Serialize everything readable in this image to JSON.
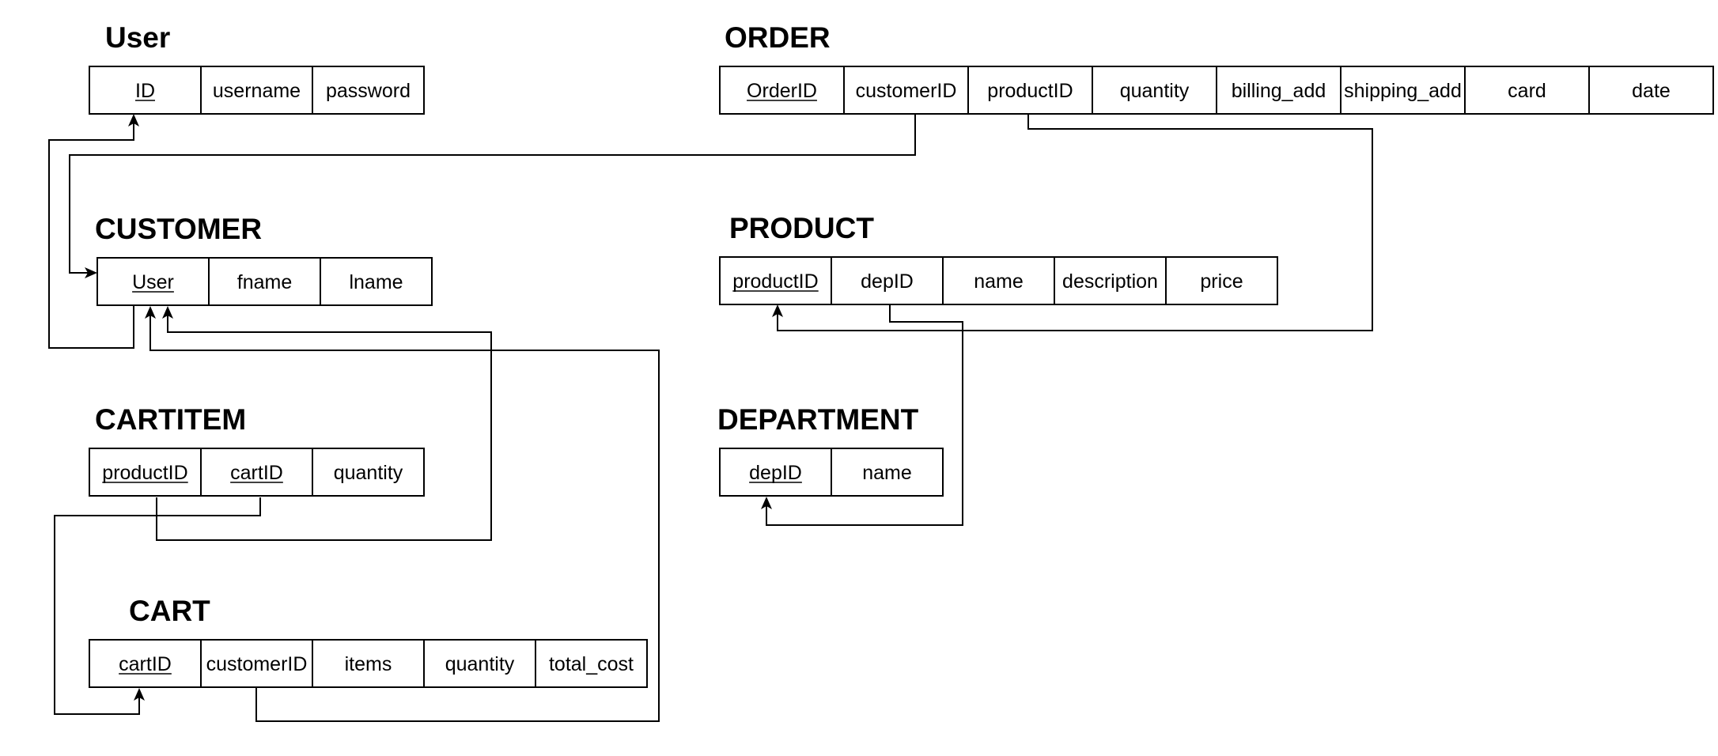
{
  "tables": [
    {
      "id": "user",
      "title": "User",
      "columns": [
        {
          "name": "ID",
          "pk": true
        },
        {
          "name": "username",
          "pk": false
        },
        {
          "name": "password",
          "pk": false
        }
      ]
    },
    {
      "id": "order",
      "title": "ORDER",
      "columns": [
        {
          "name": "OrderID",
          "pk": true
        },
        {
          "name": "customerID",
          "pk": false
        },
        {
          "name": "productID",
          "pk": false
        },
        {
          "name": "quantity",
          "pk": false
        },
        {
          "name": "billing_add",
          "pk": false
        },
        {
          "name": "shipping_add",
          "pk": false
        },
        {
          "name": "card",
          "pk": false
        },
        {
          "name": "date",
          "pk": false
        }
      ]
    },
    {
      "id": "customer",
      "title": "CUSTOMER",
      "columns": [
        {
          "name": "User",
          "pk": true
        },
        {
          "name": "fname",
          "pk": false
        },
        {
          "name": "lname",
          "pk": false
        }
      ]
    },
    {
      "id": "product",
      "title": "PRODUCT",
      "columns": [
        {
          "name": "productID",
          "pk": true
        },
        {
          "name": "depID",
          "pk": false
        },
        {
          "name": "name",
          "pk": false
        },
        {
          "name": "description",
          "pk": false
        },
        {
          "name": "price",
          "pk": false
        }
      ]
    },
    {
      "id": "cartitem",
      "title": "CARTITEM",
      "columns": [
        {
          "name": "productID",
          "pk": true
        },
        {
          "name": "cartID",
          "pk": true
        },
        {
          "name": "quantity",
          "pk": false
        }
      ]
    },
    {
      "id": "department",
      "title": "DEPARTMENT",
      "columns": [
        {
          "name": "depID",
          "pk": true
        },
        {
          "name": "name",
          "pk": false
        }
      ]
    },
    {
      "id": "cart",
      "title": "CART",
      "columns": [
        {
          "name": "cartID",
          "pk": true
        },
        {
          "name": "customerID",
          "pk": false
        },
        {
          "name": "items",
          "pk": false
        },
        {
          "name": "quantity",
          "pk": false
        },
        {
          "name": "total_cost",
          "pk": false
        }
      ]
    }
  ],
  "relationships": [
    {
      "from": "customer.User",
      "to": "user.ID"
    },
    {
      "from": "order.customerID",
      "to": "customer.User"
    },
    {
      "from": "order.productID",
      "to": "product.productID"
    },
    {
      "from": "product.depID",
      "to": "department.depID"
    },
    {
      "from": "cartitem.productID",
      "to": "customer.User"
    },
    {
      "from": "cartitem.cartID",
      "to": "cart.cartID"
    },
    {
      "from": "cart.customerID",
      "to": "customer.User"
    }
  ]
}
